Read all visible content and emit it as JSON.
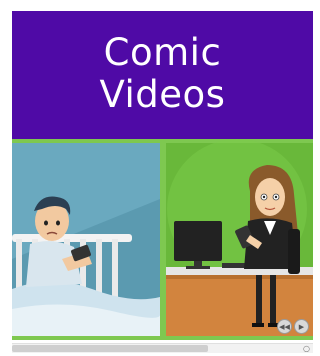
{
  "tile": {
    "title_line1": "Comic",
    "title_line2": "Videos"
  },
  "colors": {
    "tile_bg": "#4f0aa6",
    "scene_left_bg": "#5b9ab0",
    "scene_right_bg": "#6ab93a"
  },
  "controls": {
    "prev_icon": "prev-icon",
    "next_icon": "next-icon"
  }
}
